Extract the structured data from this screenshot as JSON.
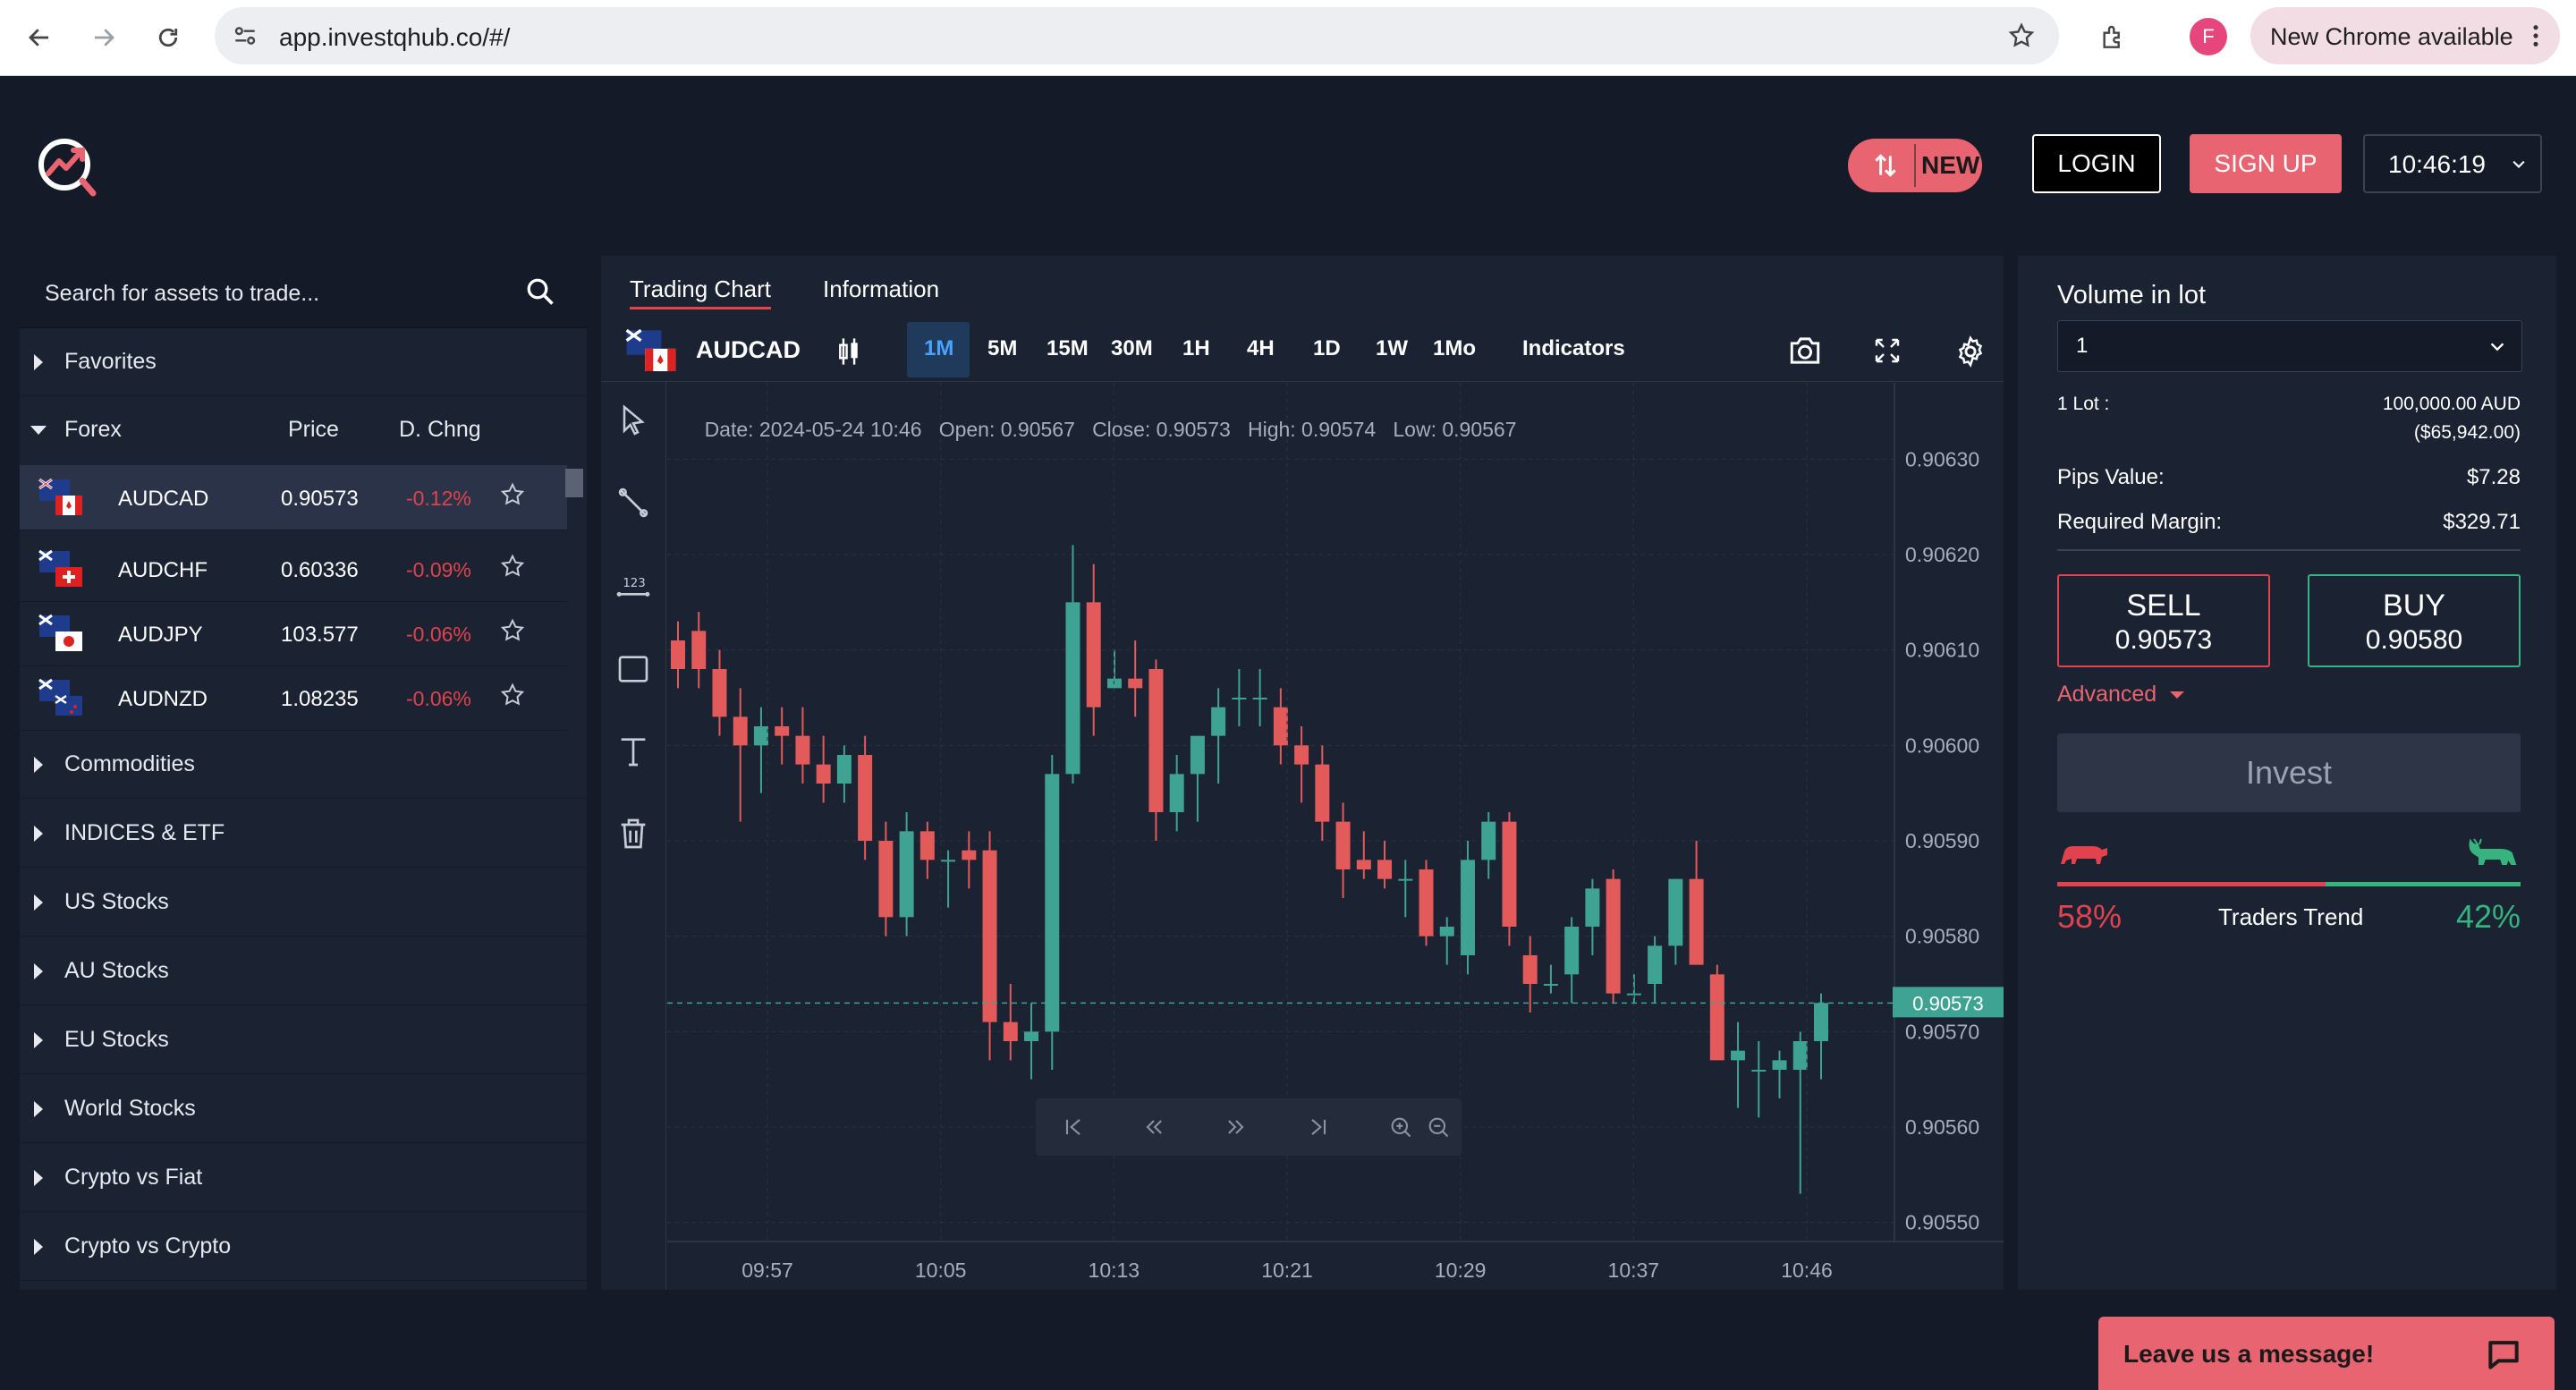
{
  "browser": {
    "url": "app.investqhub.co/#/",
    "profile_initial": "F",
    "update_label": "New Chrome available"
  },
  "header": {
    "new_label": "NEW",
    "login_label": "LOGIN",
    "signup_label": "SIGN UP",
    "clock": "10:46:19"
  },
  "assets": {
    "search_placeholder": "Search for assets to trade...",
    "favorites": "Favorites",
    "forex": {
      "label": "Forex",
      "col_price": "Price",
      "col_change": "D. Chng",
      "rows": [
        {
          "symbol": "AUDCAD",
          "price": "0.90573",
          "change": "-0.12%"
        },
        {
          "symbol": "AUDCHF",
          "price": "0.60336",
          "change": "-0.09%"
        },
        {
          "symbol": "AUDJPY",
          "price": "103.577",
          "change": "-0.06%"
        },
        {
          "symbol": "AUDNZD",
          "price": "1.08235",
          "change": "-0.06%"
        }
      ]
    },
    "categories": [
      "Commodities",
      "INDICES & ETF",
      "US Stocks",
      "AU Stocks",
      "EU Stocks",
      "World Stocks",
      "Crypto vs Fiat",
      "Crypto vs Crypto"
    ]
  },
  "chart": {
    "tabs": [
      "Trading Chart",
      "Information"
    ],
    "symbol": "AUDCAD",
    "timeframes": [
      "1M",
      "5M",
      "15M",
      "30M",
      "1H",
      "4H",
      "1D",
      "1W",
      "1Mo"
    ],
    "active_timeframe": "1M",
    "indicators_label": "Indicators",
    "ohlc": {
      "date": "Date: 2024-05-24 10:46",
      "open": "Open: 0.90567",
      "close": "Close: 0.90573",
      "high": "High: 0.90574",
      "low": "Low: 0.90567"
    },
    "current_price_label": "0.90573",
    "colors": {
      "up": "#3fa394",
      "down": "#e35a5a",
      "accent": "#e86470"
    }
  },
  "chart_data": {
    "type": "candlestick",
    "y_ticks": [
      "0.90630",
      "0.90620",
      "0.90610",
      "0.90600",
      "0.90590",
      "0.90580",
      "0.90570",
      "0.90560",
      "0.90550"
    ],
    "x_ticks": [
      "09:57",
      "10:05",
      "10:13",
      "10:21",
      "10:29",
      "10:37",
      "10:46"
    ],
    "ylim": [
      0.90548,
      0.90638
    ],
    "current_price": 0.90573,
    "candles": [
      [
        0.90611,
        0.90613,
        0.90606,
        0.90608
      ],
      [
        0.90612,
        0.90614,
        0.90606,
        0.90608
      ],
      [
        0.90608,
        0.9061,
        0.90601,
        0.90603
      ],
      [
        0.90603,
        0.90606,
        0.90592,
        0.906
      ],
      [
        0.906,
        0.90604,
        0.90595,
        0.90602
      ],
      [
        0.90602,
        0.90604,
        0.90598,
        0.90601
      ],
      [
        0.90601,
        0.90604,
        0.90596,
        0.90598
      ],
      [
        0.90598,
        0.90601,
        0.90594,
        0.90596
      ],
      [
        0.90596,
        0.906,
        0.90594,
        0.90599
      ],
      [
        0.90599,
        0.90601,
        0.90588,
        0.9059
      ],
      [
        0.9059,
        0.90592,
        0.9058,
        0.90582
      ],
      [
        0.90582,
        0.90593,
        0.9058,
        0.90591
      ],
      [
        0.90591,
        0.90592,
        0.90586,
        0.90588
      ],
      [
        0.90588,
        0.90589,
        0.90583,
        0.90588
      ],
      [
        0.90589,
        0.90591,
        0.90585,
        0.90588
      ],
      [
        0.90589,
        0.90591,
        0.90567,
        0.90571
      ],
      [
        0.90571,
        0.90575,
        0.90567,
        0.90569
      ],
      [
        0.90569,
        0.90573,
        0.90565,
        0.9057
      ],
      [
        0.9057,
        0.90599,
        0.90566,
        0.90597
      ],
      [
        0.90597,
        0.90621,
        0.90596,
        0.90615
      ],
      [
        0.90615,
        0.90619,
        0.90601,
        0.90604
      ],
      [
        0.90606,
        0.9061,
        0.90606,
        0.90607
      ],
      [
        0.90607,
        0.90611,
        0.90603,
        0.90606
      ],
      [
        0.90608,
        0.90609,
        0.9059,
        0.90593
      ],
      [
        0.90593,
        0.90599,
        0.90591,
        0.90597
      ],
      [
        0.90597,
        0.90601,
        0.90592,
        0.90601
      ],
      [
        0.90601,
        0.90606,
        0.90596,
        0.90604
      ],
      [
        0.90605,
        0.90608,
        0.90602,
        0.90605
      ],
      [
        0.90605,
        0.90608,
        0.90602,
        0.90605
      ],
      [
        0.90604,
        0.90606,
        0.90598,
        0.906
      ],
      [
        0.906,
        0.90602,
        0.90594,
        0.90598
      ],
      [
        0.90598,
        0.906,
        0.9059,
        0.90592
      ],
      [
        0.90592,
        0.90594,
        0.90584,
        0.90587
      ],
      [
        0.90588,
        0.90591,
        0.90586,
        0.90587
      ],
      [
        0.90588,
        0.9059,
        0.90585,
        0.90586
      ],
      [
        0.90586,
        0.90588,
        0.90582,
        0.90586
      ],
      [
        0.90587,
        0.90588,
        0.90579,
        0.9058
      ],
      [
        0.9058,
        0.90582,
        0.90577,
        0.90581
      ],
      [
        0.90578,
        0.9059,
        0.90576,
        0.90588
      ],
      [
        0.90588,
        0.90593,
        0.90586,
        0.90592
      ],
      [
        0.90592,
        0.90593,
        0.90579,
        0.90581
      ],
      [
        0.90578,
        0.9058,
        0.90572,
        0.90575
      ],
      [
        0.90575,
        0.90577,
        0.90574,
        0.90575
      ],
      [
        0.90576,
        0.90582,
        0.90573,
        0.90581
      ],
      [
        0.90581,
        0.90586,
        0.90578,
        0.90585
      ],
      [
        0.90586,
        0.90587,
        0.90573,
        0.90574
      ],
      [
        0.90574,
        0.90576,
        0.90573,
        0.90574
      ],
      [
        0.90575,
        0.9058,
        0.90573,
        0.90579
      ],
      [
        0.90579,
        0.90586,
        0.90577,
        0.90586
      ],
      [
        0.90586,
        0.9059,
        0.90577,
        0.90577
      ],
      [
        0.90576,
        0.90577,
        0.90567,
        0.90567
      ],
      [
        0.90567,
        0.90571,
        0.90562,
        0.90568
      ],
      [
        0.90566,
        0.90569,
        0.90561,
        0.90566
      ],
      [
        0.90566,
        0.90568,
        0.90563,
        0.90567
      ],
      [
        0.90566,
        0.9057,
        0.90553,
        0.90569
      ],
      [
        0.90569,
        0.90574,
        0.90565,
        0.90573
      ]
    ]
  },
  "trade": {
    "volume_label": "Volume in lot",
    "volume_value": "1",
    "lot_label": "1 Lot :",
    "lot_value": "100,000.00 AUD",
    "lot_value_usd": "($65,942.00)",
    "pips_label": "Pips Value:",
    "pips_value": "$7.28",
    "margin_label": "Required Margin:",
    "margin_value": "$329.71",
    "sell_label": "SELL",
    "sell_price": "0.90573",
    "buy_label": "BUY",
    "buy_price": "0.90580",
    "advanced_label": "Advanced",
    "invest_label": "Invest",
    "sell_pct": "58%",
    "buy_pct": "42%",
    "sell_fraction": 0.58,
    "trend_label": "Traders Trend"
  },
  "chat": {
    "label": "Leave us a message!"
  }
}
